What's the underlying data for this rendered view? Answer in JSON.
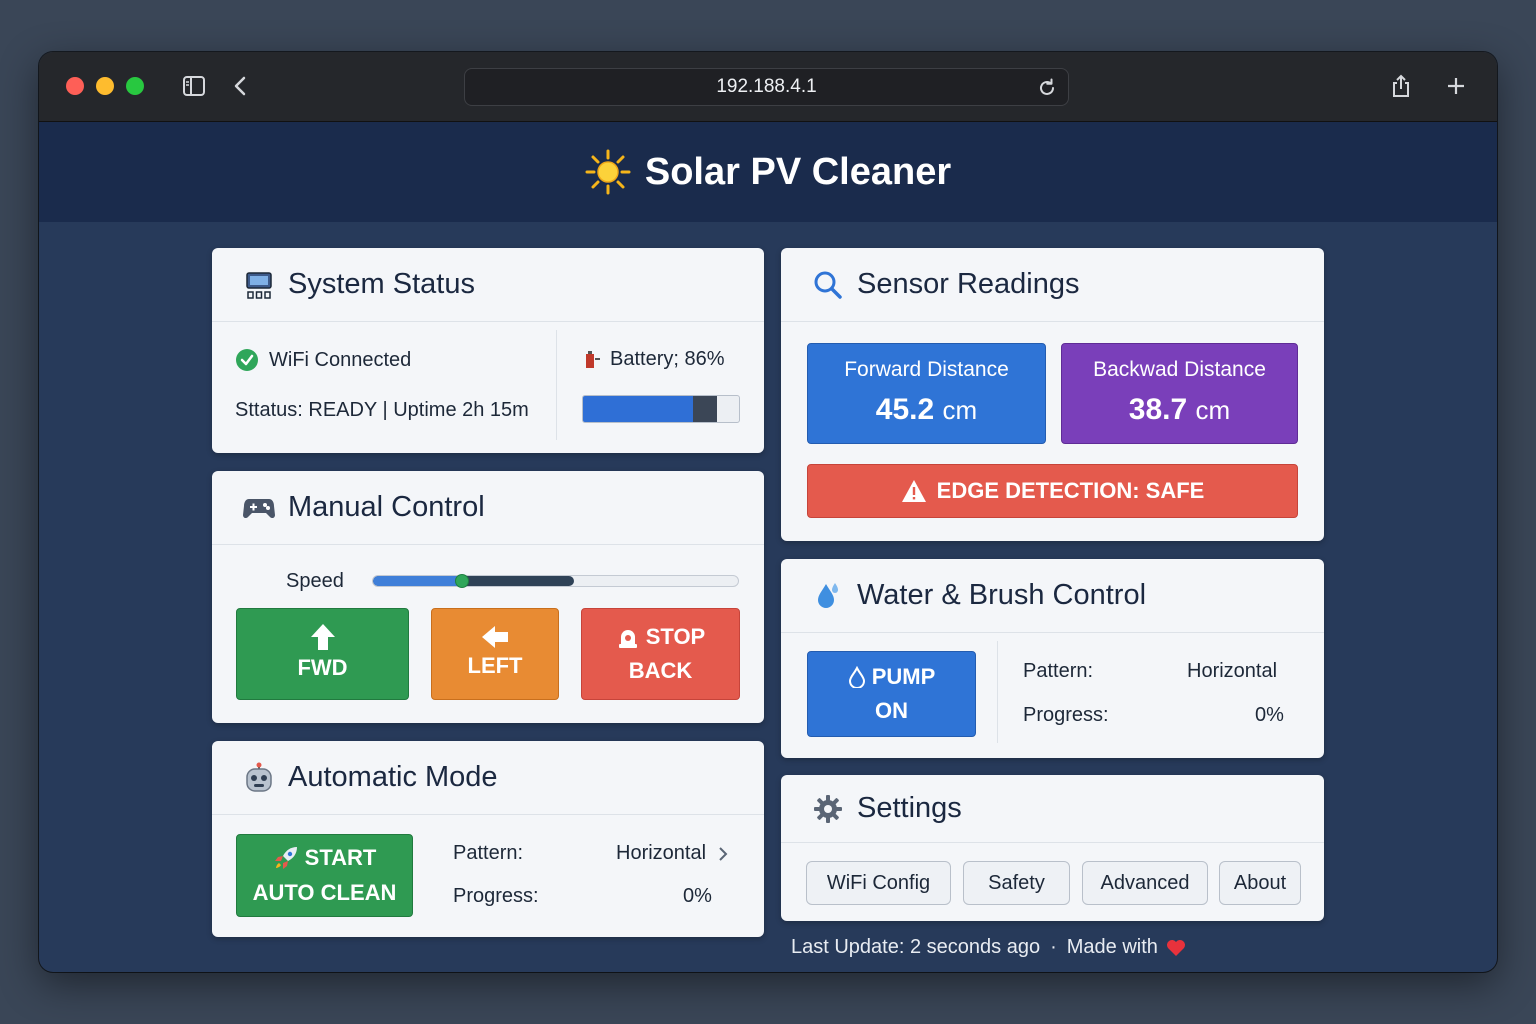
{
  "browser": {
    "url": "192.188.4.1"
  },
  "header": {
    "title": "Solar PV Cleaner",
    "icon": "sun-icon"
  },
  "system_status": {
    "title": "System Status",
    "wifi": "WiFi Connected",
    "status_line": "Sttatus: READY | Uptime 2h 15m",
    "battery_label": "Battery; 86%",
    "battery_level": 0.86,
    "icons": [
      "monitor-icon",
      "check-circle-icon",
      "battery-icon"
    ]
  },
  "manual_control": {
    "title": "Manual Control",
    "speed_label": "Speed",
    "speed_level": 0.55,
    "fwd": "FWD",
    "left": "LEFT",
    "stop": "STOP",
    "back": "BACK"
  },
  "automatic_mode": {
    "title": "Automatic Mode",
    "start_line1": "START",
    "start_line2": "AUTO CLEAN",
    "pattern_label": "Pattern:",
    "pattern_value": "Horizontal",
    "progress_label": "Progress:",
    "progress_value": "0%"
  },
  "sensor_readings": {
    "title": "Sensor Readings",
    "forward_label": "Forward Distance",
    "forward_value": "45.2",
    "backward_label": "Backwad Distance",
    "backward_value": "38.7",
    "unit": "cm",
    "edge": "EDGE DETECTION: SAFE"
  },
  "water_brush": {
    "title": "Water & Brush Control",
    "pump_line1": "PUMP",
    "pump_line2": "ON",
    "pattern_label": "Pattern:",
    "pattern_value": "Horizontal",
    "progress_label": "Progress:",
    "progress_value": "0%"
  },
  "settings": {
    "title": "Settings",
    "buttons": [
      "WiFi Config",
      "Safety",
      "Advanced",
      "About"
    ]
  },
  "footer": {
    "last_update": "Last Update: 2 seconds ago",
    "separator": "·",
    "made_with": "Made with"
  },
  "colors": {
    "header_bg": "#1a2b4c",
    "page_bg": "#273a5a",
    "green": "#2f9a52",
    "orange": "#e88b33",
    "red": "#e45a4d",
    "blue": "#2f74d6",
    "purple": "#7a3fba"
  }
}
